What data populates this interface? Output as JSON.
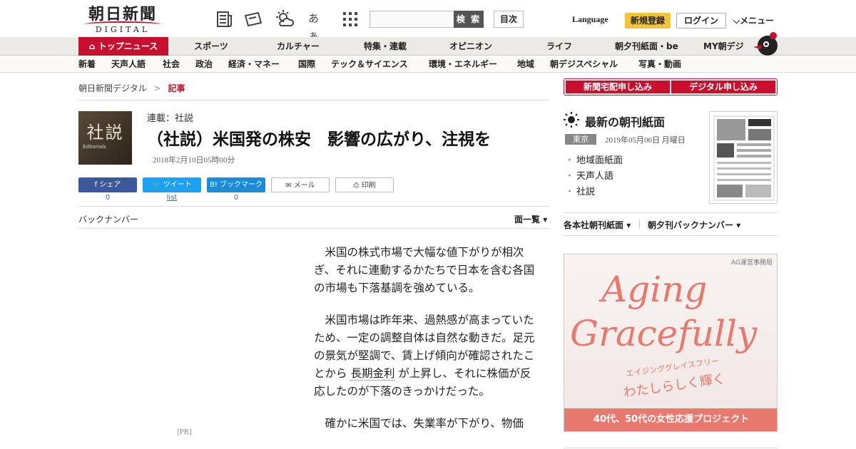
{
  "header": {
    "logo_main": "朝日新聞",
    "logo_sub": "DIGITAL",
    "search_placeholder": "",
    "search_button": "検 索",
    "toc_button": "目次",
    "language": "Language",
    "signup": "新規登録",
    "login": "ログイン",
    "menu": "メニュー",
    "icons": [
      "newspaper-icon",
      "coupon-icon",
      "weather-icon",
      "font-size-icon",
      "grid-menu-icon"
    ],
    "font_icon_text": "あぁ"
  },
  "nav1": [
    "トップニュース",
    "スポーツ",
    "カルチャー",
    "特集・連載",
    "オピニオン",
    "ライフ",
    "朝夕刊紙面・be",
    "MY朝デジ"
  ],
  "nav2": [
    "新着",
    "天声人語",
    "社会",
    "政治",
    "経済・マネー",
    "国際",
    "テック＆サイエンス",
    "環境・エネルギー",
    "地域",
    "朝デジスペシャル",
    "写真・動画"
  ],
  "breadcrumb": {
    "home": "朝日新聞デジタル",
    "sep": ">",
    "current": "記事"
  },
  "article": {
    "logo_kanji": "社説",
    "logo_en": "Editorials",
    "series": "連載：社説",
    "title": "（社説）米国発の株安　影響の広がり、注視を",
    "date": "2018年2月10日05時00分",
    "share": [
      {
        "label": "シェア",
        "count": "0",
        "color": "#3b5998"
      },
      {
        "label": "ツイート",
        "count": "list",
        "color": "#1da1f2"
      },
      {
        "label": "ブックマーク",
        "count": "0",
        "color": "#1a8cd8"
      },
      {
        "label": "メール",
        "count": ""
      },
      {
        "label": "印刷",
        "count": ""
      }
    ],
    "back_number": "バックナンバー",
    "page_list": "面一覧",
    "pr": "[PR]",
    "p1": "米国の株式市場で大幅な値下がりが相次ぎ、それに連動するかたちで日本を含む各国の市場も下落基調を強めている。",
    "p2a": "米国市場は昨年来、過熱感が高まっていたため、一定の調整自体は自然な動きだ。足元の景気が堅調で、賃上げ傾向が確認されたことから",
    "p2link": "長期金利",
    "p2b": "が上昇し、それに株価が反応したのが下落のきっかけだった。",
    "p3": "確かに米国では、失業率が下がり、物価"
  },
  "sidebar": {
    "btn1": "新聞宅配申し込み",
    "btn2": "デジタル申し込み",
    "latest_title": "最新の朝刊紙面",
    "region": "東京",
    "paper_date": "2019年05月06日 月曜日",
    "links": [
      "地域面紙面",
      "天声人語",
      "社説"
    ],
    "link_a": "各本社朝刊紙面",
    "link_b": "朝夕刊バックナンバー"
  },
  "ad": {
    "sponsor": "AG運営事務局",
    "word1": "Aging",
    "word2": "Gracefully",
    "kana": "エイジンググレイスフリー",
    "tagline": "わたしらしく輝く",
    "bottom": "40代、50代の女性応援プロジェクト"
  },
  "colors": {
    "brand_red": "#c8102e",
    "signup_yellow": "#f3c437",
    "ad_coral": "#e8796f"
  }
}
